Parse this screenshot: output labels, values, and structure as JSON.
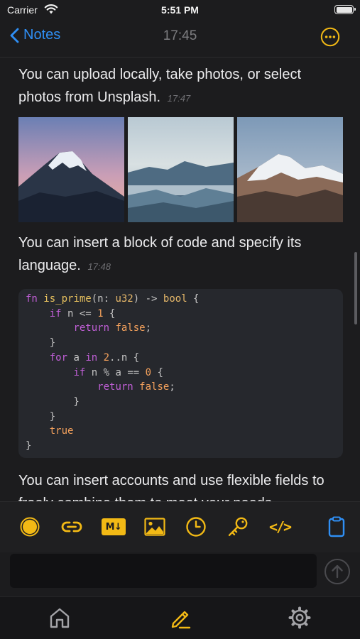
{
  "status_bar": {
    "carrier": "Carrier",
    "time": "5:51 PM"
  },
  "nav": {
    "back_label": "Notes",
    "title": "17:45"
  },
  "content": {
    "paragraph_1": {
      "text": "You can upload locally, take photos, or select photos from Unsplash.",
      "time": "17:47"
    },
    "paragraph_2": {
      "text": "You can insert a block of code and specify its language.",
      "time": "17:48"
    },
    "paragraph_3": {
      "text": "You can insert accounts and use flexible fields to freely combine them to meet your needs"
    },
    "code_language": "rust"
  },
  "toolbar": {
    "items": [
      "record-icon",
      "link-icon",
      "markdown-icon",
      "image-icon",
      "clock-icon",
      "key-icon",
      "code-icon",
      "clipboard-icon"
    ],
    "markdown_badge": "M↓",
    "code_glyph": "</>"
  },
  "input": {
    "value": "",
    "placeholder": ""
  },
  "tab_bar": {
    "items": [
      "home-icon",
      "edit-icon",
      "settings-icon"
    ],
    "active": "edit-icon"
  },
  "colors": {
    "accent": "#f2b915",
    "link": "#2f8ff5",
    "background": "#1c1c1e",
    "code_background": "#26282d"
  }
}
